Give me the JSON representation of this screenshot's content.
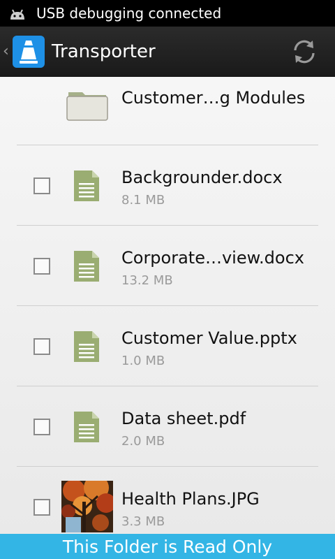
{
  "status_bar": {
    "notification_text": "USB debugging connected",
    "icon": "android-icon"
  },
  "action_bar": {
    "title": "Transporter",
    "app_icon": "transporter-cone-icon",
    "refresh_icon": "refresh-icon"
  },
  "files": [
    {
      "name": "Customer…g Modules",
      "size": "",
      "type": "folder"
    },
    {
      "name": "Backgrounder.docx",
      "size": "8.1 MB",
      "type": "document"
    },
    {
      "name": "Corporate…view.docx",
      "size": "13.2 MB",
      "type": "document"
    },
    {
      "name": "Customer Value.pptx",
      "size": "1.0 MB",
      "type": "document"
    },
    {
      "name": "Data sheet.pdf",
      "size": "2.0 MB",
      "type": "document"
    },
    {
      "name": "Health Plans.JPG",
      "size": "3.3 MB",
      "type": "image"
    }
  ],
  "footer": {
    "message": "This Folder is Read Only"
  },
  "colors": {
    "accent": "#33b5e5",
    "app_icon_bg": "#1e90e6",
    "doc_icon": "#9aad72"
  }
}
